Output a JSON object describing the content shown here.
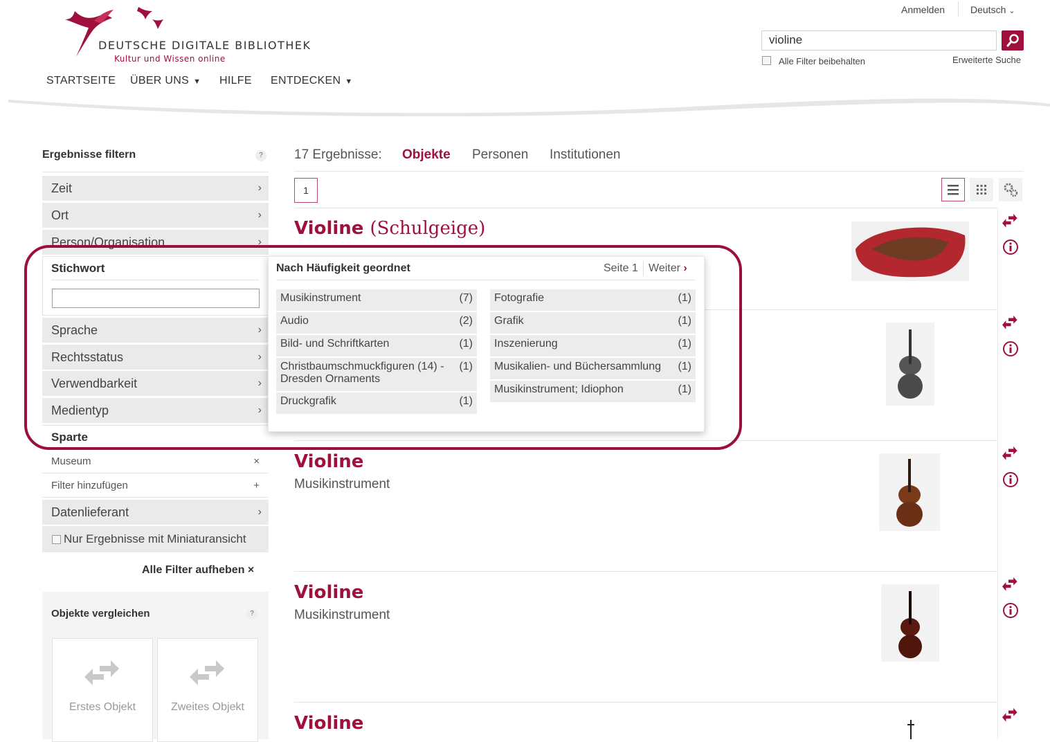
{
  "header": {
    "logo_title": "DEUTSCHE DIGITALE BIBLIOTHEK",
    "logo_subtitle": "Kultur und Wissen online",
    "login": "Anmelden",
    "language": "Deutsch",
    "nav": [
      "STARTSEITE",
      "ÜBER UNS",
      "HILFE",
      "ENTDECKEN"
    ],
    "search_value": "violine",
    "keep_filters_label": "Alle Filter beibehalten",
    "advanced_search": "Erweiterte Suche"
  },
  "sidebar": {
    "title": "Ergebnisse filtern",
    "help": "?",
    "facets_top": [
      "Zeit",
      "Ort",
      "Person/Organisation"
    ],
    "stichwort_label": "Stichwort",
    "facets_mid": [
      "Sprache",
      "Rechtsstatus",
      "Verwendbarkeit",
      "Medientyp"
    ],
    "sparte_label": "Sparte",
    "sparte_items": [
      {
        "label": "Museum",
        "symbol": "×"
      },
      {
        "label": "Filter hinzufügen",
        "symbol": "+"
      }
    ],
    "datenlieferant": "Datenlieferant",
    "miniatur_label": "Nur Ergebnisse mit Miniaturansicht",
    "clear_all": "Alle Filter aufheben ×",
    "compare_title": "Objekte vergleichen",
    "compare_slots": [
      "Erstes Objekt",
      "Zweites Objekt"
    ]
  },
  "results": {
    "count_label": "17 Ergebnisse:",
    "tabs": [
      "Objekte",
      "Personen",
      "Institutionen"
    ],
    "page": "1",
    "items": [
      {
        "title": "Violine",
        "title_extra": "(Schulgeige)",
        "subtitle": ""
      },
      {
        "title": "Violine",
        "title_extra": "",
        "subtitle": "Musikinstrument"
      },
      {
        "title": "Violine",
        "title_extra": "",
        "subtitle": "Musikinstrument"
      },
      {
        "title": "Violine",
        "title_extra": "",
        "subtitle": ""
      }
    ]
  },
  "popup": {
    "heading": "Nach Häufigkeit geordnet",
    "page_label": "Seite 1",
    "next_label": "Weiter",
    "left": [
      {
        "label": "Musikinstrument",
        "count": "(7)"
      },
      {
        "label": "Audio",
        "count": "(2)"
      },
      {
        "label": "Bild- und Schriftkarten",
        "count": "(1)"
      },
      {
        "label": "Christbaumschmuckfiguren (14) - Dresden Ornaments",
        "count": "(1)"
      },
      {
        "label": "Druckgrafik",
        "count": "(1)"
      }
    ],
    "right": [
      {
        "label": "Fotografie",
        "count": "(1)"
      },
      {
        "label": "Grafik",
        "count": "(1)"
      },
      {
        "label": "Inszenierung",
        "count": "(1)"
      },
      {
        "label": "Musikalien- und Büchersammlung",
        "count": "(1)"
      },
      {
        "label": "Musikinstrument; Idiophon",
        "count": "(1)"
      }
    ]
  },
  "colors": {
    "accent": "#a0103c",
    "highlight_border": "#9a0f3c"
  }
}
